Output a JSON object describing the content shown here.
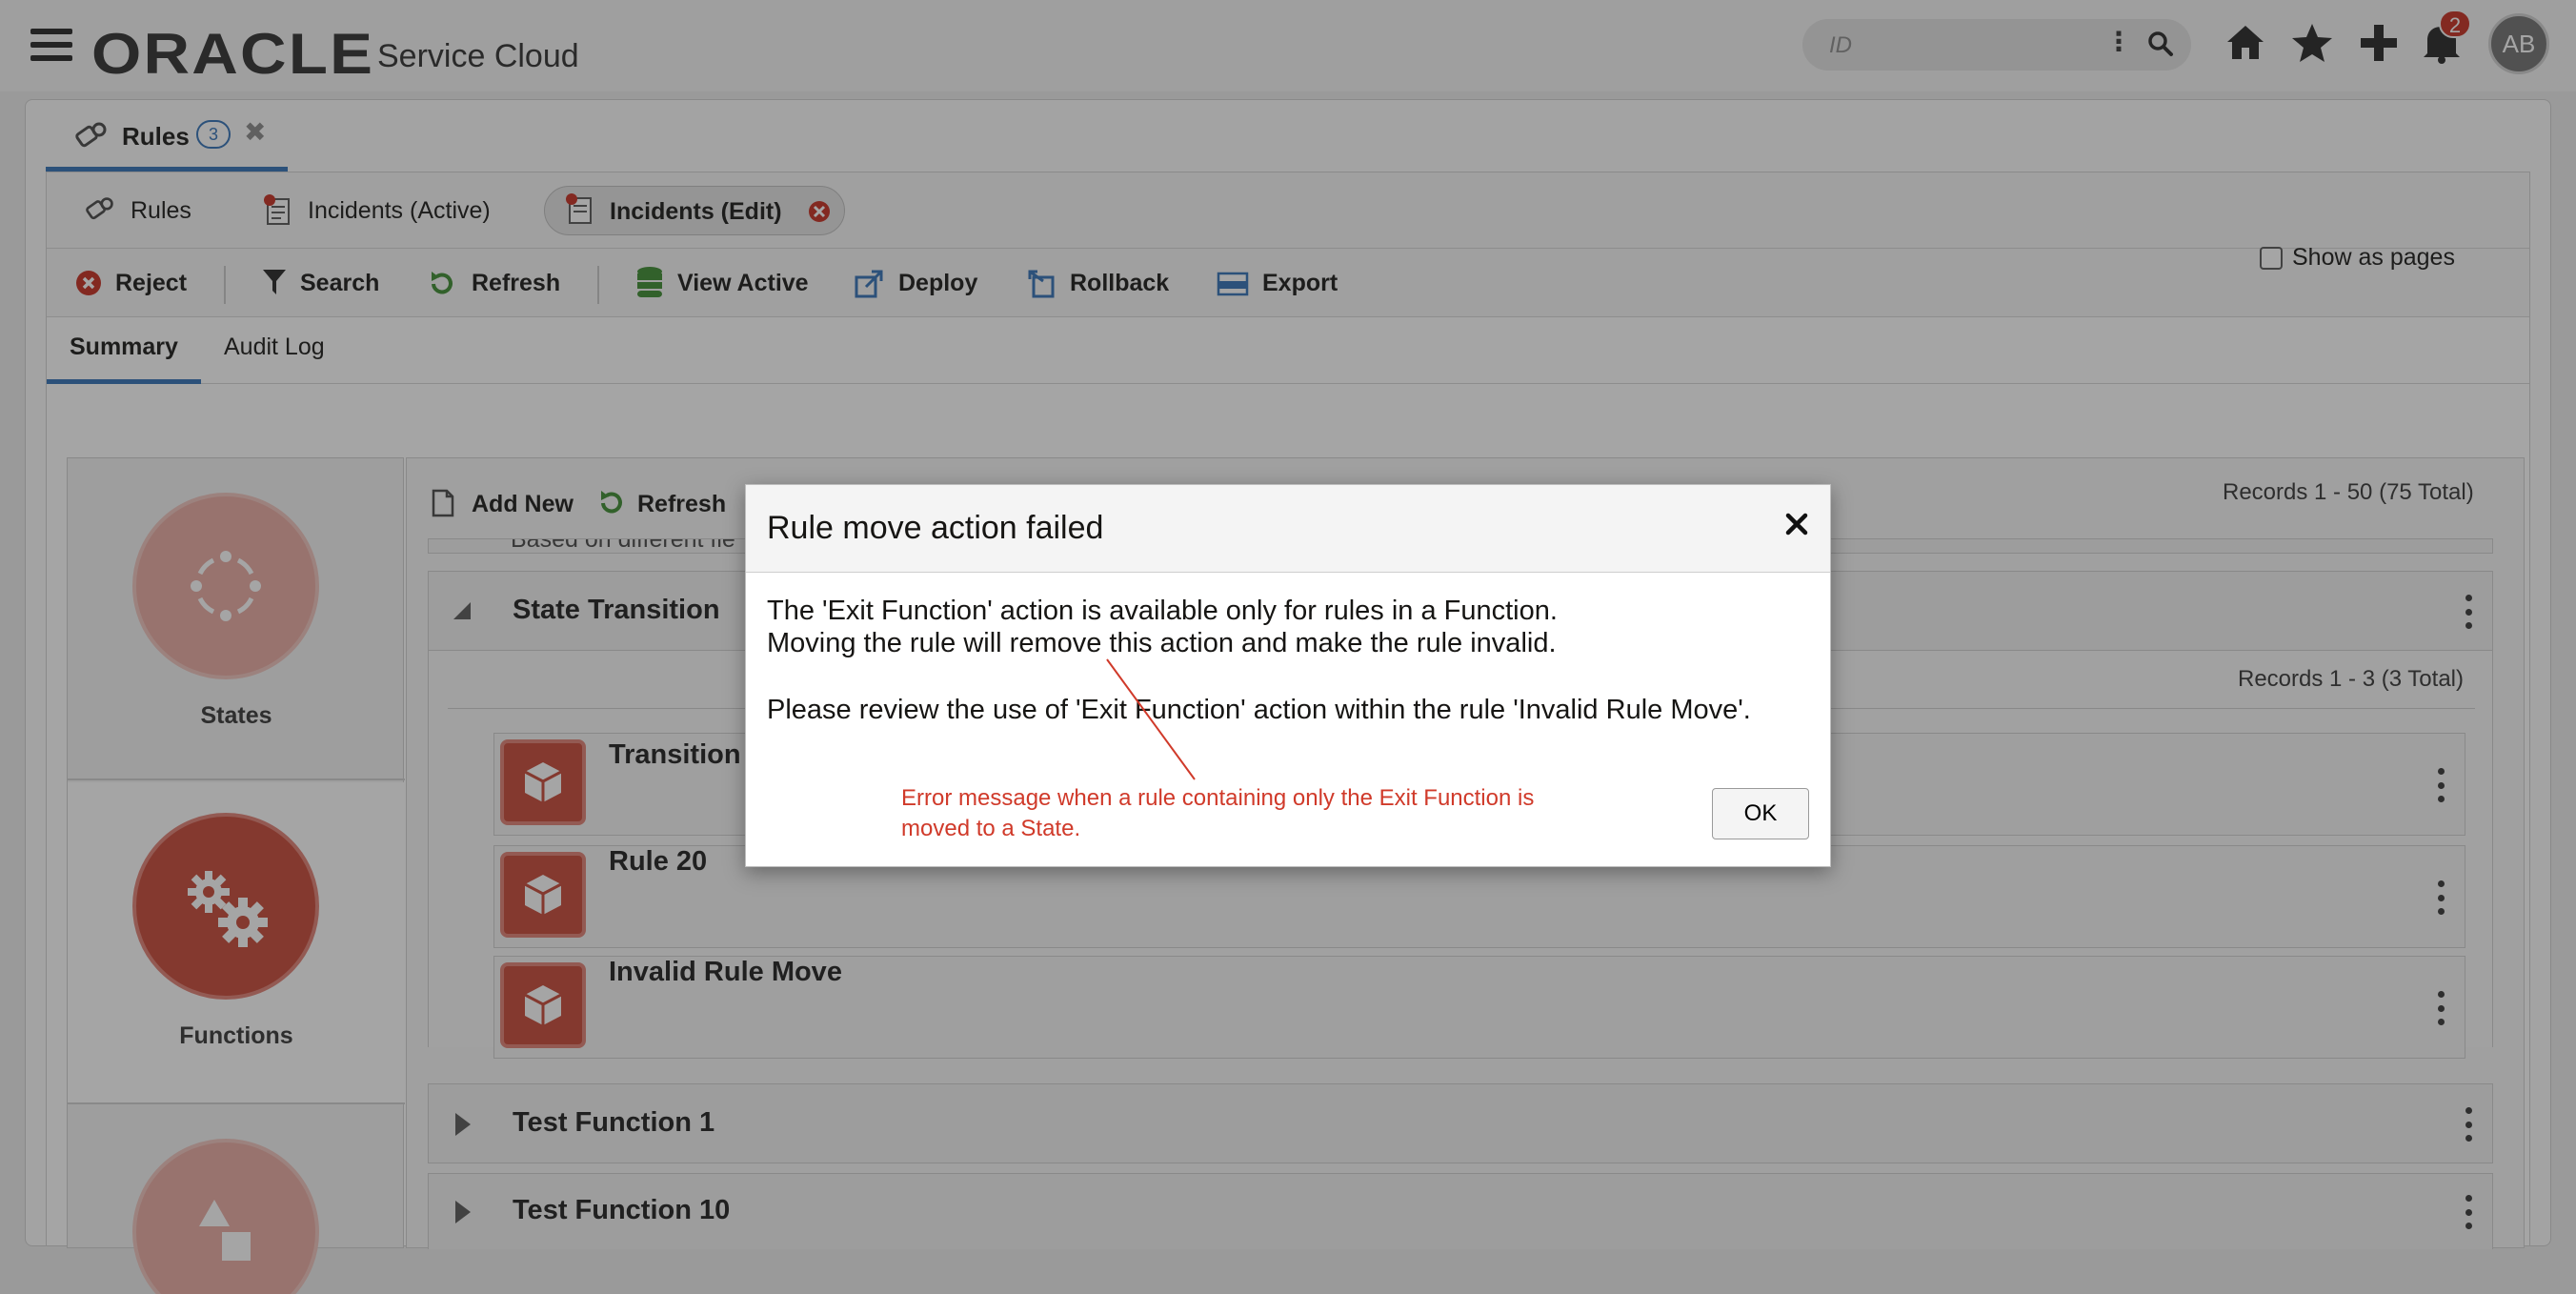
{
  "header": {
    "brand": "ORACLE",
    "product": "Service Cloud",
    "search_placeholder": "ID",
    "notification_count": "2",
    "avatar_initials": "AB"
  },
  "main_tab": {
    "label": "Rules",
    "count": "3"
  },
  "sub_tabs": [
    {
      "label": "Rules"
    },
    {
      "label": "Incidents (Active)"
    },
    {
      "label": "Incidents (Edit)"
    }
  ],
  "toolbar": {
    "reject": "Reject",
    "search": "Search",
    "refresh": "Refresh",
    "view_active": "View Active",
    "deploy": "Deploy",
    "rollback": "Rollback",
    "export": "Export"
  },
  "view_tabs": {
    "summary": "Summary",
    "audit_log": "Audit Log"
  },
  "show_as_pages": "Show as pages",
  "rail": {
    "states": "States",
    "functions": "Functions"
  },
  "list": {
    "add_new": "Add New",
    "refresh": "Refresh",
    "records_outer": "Records 1 - 50 (75 Total)",
    "partial_text": "Based on different fie",
    "group_state_transition": "State Transition",
    "records_inner": "Records 1 - 3 (3 Total)",
    "rules": [
      "Transition",
      "Rule 20",
      "Invalid Rule Move"
    ],
    "group_test_function_1": "Test Function 1",
    "group_test_function_10": "Test Function 10"
  },
  "dialog": {
    "title": "Rule move action failed",
    "line1": "The 'Exit Function' action is available only for rules in a Function.",
    "line2": "Moving the rule will remove this action and make the rule invalid.",
    "line3": "Please review the use of 'Exit Function' action within the rule 'Invalid Rule Move'.",
    "ok": "OK"
  },
  "annotation": {
    "line1": "Error message when a rule containing only the Exit Function is",
    "line2": "moved to a State.",
    "color": "#d03a2a"
  },
  "colors": {
    "accent": "#2f6fb6",
    "rule_red": "#c74634",
    "reject_red": "#c52a1d",
    "refresh_green": "#3a8a2e"
  }
}
